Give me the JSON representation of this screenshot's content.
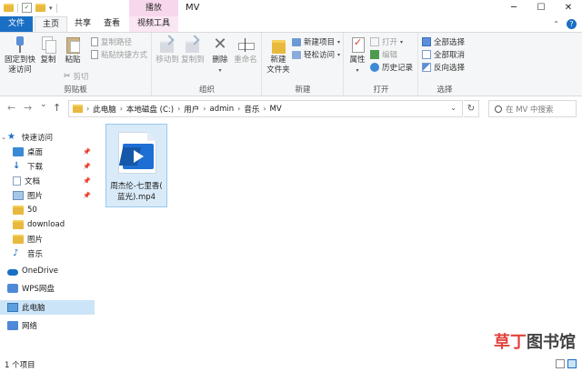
{
  "titlebar": {
    "context_tab_header": "播放",
    "window_title": "MV",
    "quick_access_check": "✓",
    "minimize": "─",
    "maximize": "☐",
    "close": "✕"
  },
  "tabs": {
    "file": "文件",
    "home": "主页",
    "share": "共享",
    "view": "查看",
    "video_tools": "视频工具",
    "help": "?"
  },
  "ribbon": {
    "clipboard": {
      "label": "剪贴板",
      "pin_quick_access": "固定到快\n速访问",
      "copy": "复制",
      "paste": "粘贴",
      "copy_path": "复制路径",
      "paste_shortcut": "粘贴快捷方式",
      "cut": "剪切"
    },
    "organize": {
      "label": "组织",
      "move_to": "移动到",
      "copy_to": "复制到",
      "delete": "删除",
      "rename": "重命名"
    },
    "new": {
      "label": "新建",
      "new_folder": "新建\n文件夹",
      "new_item": "新建项目",
      "easy_access": "轻松访问"
    },
    "open": {
      "label": "打开",
      "properties": "属性",
      "open": "打开",
      "edit": "编辑",
      "history": "历史记录"
    },
    "select": {
      "label": "选择",
      "select_all": "全部选择",
      "select_none": "全部取消",
      "invert": "反向选择"
    }
  },
  "navigation": {
    "back": "←",
    "forward": "→",
    "recent": "⌄",
    "up": "↑",
    "breadcrumb": [
      "此电脑",
      "本地磁盘 (C:)",
      "用户",
      "admin",
      "音乐",
      "MV"
    ],
    "refresh": "↻",
    "search_placeholder": "在 MV 中搜索"
  },
  "sidebar": {
    "items": [
      {
        "label": "快速访问",
        "icon": "star-icon"
      },
      {
        "label": "桌面",
        "icon": "desktop-icon",
        "pinned": true
      },
      {
        "label": "下载",
        "icon": "download-icon",
        "pinned": true
      },
      {
        "label": "文档",
        "icon": "document-icon",
        "pinned": true
      },
      {
        "label": "图片",
        "icon": "picture-icon",
        "pinned": true
      },
      {
        "label": "50",
        "icon": "folder-icon"
      },
      {
        "label": "download",
        "icon": "folder-icon"
      },
      {
        "label": "图片",
        "icon": "folder-icon"
      },
      {
        "label": "音乐",
        "icon": "music-icon"
      },
      {
        "label": "OneDrive",
        "icon": "cloud-icon"
      },
      {
        "label": "WPS网盘",
        "icon": "wps-cloud-icon"
      },
      {
        "label": "此电脑",
        "icon": "computer-icon",
        "selected": true
      },
      {
        "label": "网络",
        "icon": "network-icon"
      }
    ]
  },
  "files": [
    {
      "name": "周杰伦-七里香(蓝光).mp4",
      "name_line1": "周杰伦-七里香(",
      "name_line2": "蓝光).mp4",
      "type": "video-file-icon"
    }
  ],
  "status": {
    "item_count": "1 个项目"
  },
  "watermark": {
    "part1": "草丁",
    "part2": "图书馆"
  },
  "colors": {
    "accent": "#1a6fc4",
    "selection": "#cce4f7",
    "context_tab": "#f7d7ec",
    "watermark": "#e0433b"
  }
}
